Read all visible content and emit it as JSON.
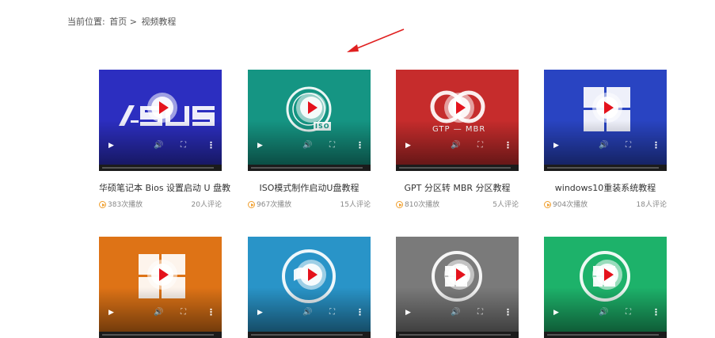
{
  "breadcrumb": {
    "prefix": "当前位置:",
    "home": "首页",
    "separator": ">",
    "current": "视频教程"
  },
  "thumb_logos": {
    "gpt_mbr": "GTP — MBR",
    "iso": "ISO"
  },
  "videos": [
    {
      "title": "华硕笔记本 Bios 设置启动 U 盘教",
      "plays": "383次播放",
      "comments": "20人评论",
      "bg": "#2c2ec0",
      "logo": "asus-logo"
    },
    {
      "title": "ISO模式制作启动U盘教程",
      "plays": "967次播放",
      "comments": "15人评论",
      "bg": "#159583",
      "logo": "iso-disc-logo"
    },
    {
      "title": "GPT 分区转 MBR 分区教程",
      "plays": "810次播放",
      "comments": "5人评论",
      "bg": "#c62c2c",
      "logo": "gpt-mbr-logo"
    },
    {
      "title": "windows10重装系统教程",
      "plays": "904次播放",
      "comments": "18人评论",
      "bg": "#2944c2",
      "logo": "windows-logo"
    },
    {
      "title": "",
      "plays": "",
      "comments": "",
      "bg": "#de7316",
      "logo": "windows-logo"
    },
    {
      "title": "",
      "plays": "",
      "comments": "",
      "bg": "#2994c8",
      "logo": "windows-xp-logo"
    },
    {
      "title": "",
      "plays": "",
      "comments": "",
      "bg": "#7a7a7a",
      "logo": "windows-circle-logo"
    },
    {
      "title": "",
      "plays": "",
      "comments": "",
      "bg": "#1db26a",
      "logo": "windows-circle-logo"
    }
  ],
  "colors": {
    "accent": "#f0a030",
    "play_button": "#e4121c",
    "arrow": "#e02020"
  }
}
